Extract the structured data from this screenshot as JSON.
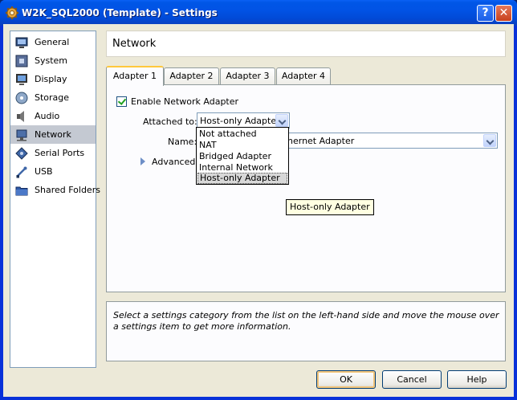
{
  "window": {
    "title": "W2K_SQL2000 (Template) - Settings",
    "help_glyph": "?",
    "close_glyph": "✕"
  },
  "sidebar": {
    "items": [
      {
        "label": "General",
        "icon": "general-icon"
      },
      {
        "label": "System",
        "icon": "system-icon"
      },
      {
        "label": "Display",
        "icon": "display-icon"
      },
      {
        "label": "Storage",
        "icon": "storage-icon"
      },
      {
        "label": "Audio",
        "icon": "audio-icon"
      },
      {
        "label": "Network",
        "icon": "network-icon",
        "selected": true
      },
      {
        "label": "Serial Ports",
        "icon": "serial-ports-icon"
      },
      {
        "label": "USB",
        "icon": "usb-icon"
      },
      {
        "label": "Shared Folders",
        "icon": "shared-folders-icon"
      }
    ]
  },
  "header": {
    "title": "Network"
  },
  "tabs": [
    {
      "label": "Adapter 1",
      "active": true
    },
    {
      "label": "Adapter 2"
    },
    {
      "label": "Adapter 3"
    },
    {
      "label": "Adapter 4"
    }
  ],
  "adapter": {
    "enable_label": "Enable Network Adapter",
    "enabled": true,
    "attached_label": "Attached to:",
    "attached_value": "Host-only Adapter",
    "name_label": "Name:",
    "name_value_visible": "hernet Adapter",
    "advanced_label": "Advanced",
    "dropdown_options": [
      "Not attached",
      "NAT",
      "Bridged Adapter",
      "Internal Network",
      "Host-only Adapter"
    ],
    "highlighted_option": "Host-only Adapter"
  },
  "tooltip": "Host-only Adapter",
  "description": "Select a settings category from the list on the left-hand side and move the mouse over a settings item to get more information.",
  "buttons": {
    "ok": "OK",
    "cancel": "Cancel",
    "help": "Help"
  },
  "colors": {
    "title_bar": "#0153e5",
    "dialog_bg": "#ece9d8",
    "selected_item": "#c4c9d2",
    "tab_highlight": "#ffc83c"
  }
}
